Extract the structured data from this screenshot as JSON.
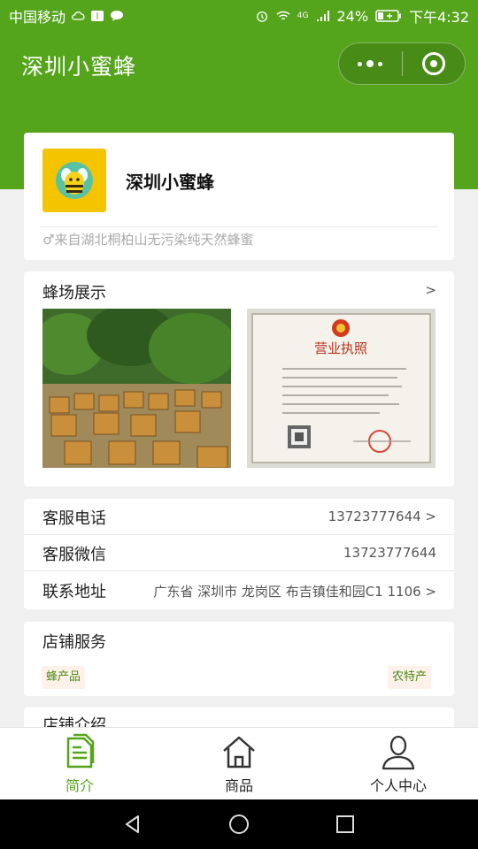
{
  "status_bar": {
    "carrier": "中国移动",
    "network": "4G",
    "battery": "24%",
    "time": "下午4:32"
  },
  "header": {
    "title": "深圳小蜜蜂"
  },
  "profile": {
    "name": "深圳小蜜蜂",
    "tagline": "♂来自湖北桐柏山无污染纯天然蜂蜜"
  },
  "showcase": {
    "title": "蜂场展示",
    "arrow": ">",
    "certificate_title": "营业执照"
  },
  "contact": {
    "rows": [
      {
        "label": "客服电话",
        "value": "13723777644 >"
      },
      {
        "label": "客服微信",
        "value": "13723777644"
      },
      {
        "label": "联系地址",
        "value": "广东省 深圳市 龙岗区 布吉镇佳和园C1 1106 >"
      }
    ]
  },
  "services": {
    "title": "店铺服务",
    "tags": [
      "蜂产品",
      "农特产"
    ]
  },
  "intro": {
    "title": "店铺介绍"
  },
  "tabs": [
    {
      "label": "简介",
      "icon": "document-icon",
      "active": true
    },
    {
      "label": "商品",
      "icon": "home-icon",
      "active": false
    },
    {
      "label": "个人中心",
      "icon": "person-icon",
      "active": false
    }
  ],
  "colors": {
    "brand_green": "#55a51c",
    "tag_bg": "#fdf1ea",
    "bee_yellow": "#f5c400"
  }
}
